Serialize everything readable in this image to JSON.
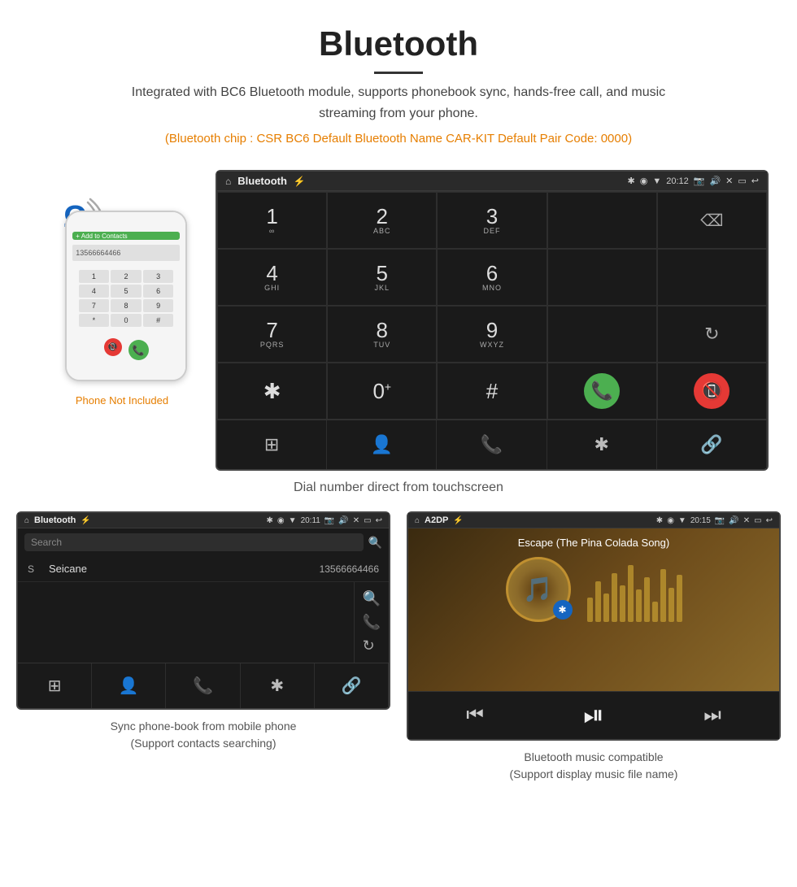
{
  "header": {
    "title": "Bluetooth",
    "subtitle": "Integrated with BC6 Bluetooth module, supports phonebook sync, hands-free call, and music streaming from your phone.",
    "orange_info": "(Bluetooth chip : CSR BC6    Default Bluetooth Name CAR-KIT    Default Pair Code: 0000)"
  },
  "dial_screen": {
    "statusbar": {
      "label": "Bluetooth",
      "time": "20:12",
      "icons": [
        "home",
        "bluetooth",
        "usb",
        "location",
        "signal"
      ]
    },
    "keypad": [
      {
        "num": "1",
        "sub": ""
      },
      {
        "num": "2",
        "sub": "ABC"
      },
      {
        "num": "3",
        "sub": "DEF"
      },
      {
        "empty": true
      },
      {
        "backspace": true
      },
      {
        "num": "4",
        "sub": "GHI"
      },
      {
        "num": "5",
        "sub": "JKL"
      },
      {
        "num": "6",
        "sub": "MNO"
      },
      {
        "empty": true
      },
      {
        "empty": true
      },
      {
        "num": "7",
        "sub": "PQRS"
      },
      {
        "num": "8",
        "sub": "TUV"
      },
      {
        "num": "9",
        "sub": "WXYZ"
      },
      {
        "empty": true
      },
      {
        "redial": true
      },
      {
        "num": "*",
        "sub": ""
      },
      {
        "num": "0",
        "sub": "+"
      },
      {
        "num": "#",
        "sub": ""
      },
      {
        "call_green": true
      },
      {
        "call_red": true
      }
    ],
    "bottom_icons": [
      "grid",
      "person",
      "phone",
      "bluetooth",
      "link"
    ],
    "caption": "Dial number direct from touchscreen"
  },
  "phonebook_screen": {
    "statusbar": {
      "label": "Bluetooth",
      "time": "20:11"
    },
    "search_placeholder": "Search",
    "contacts": [
      {
        "letter": "S",
        "name": "Seicane",
        "phone": "13566664466"
      }
    ],
    "bottom_icons": [
      "grid",
      "person",
      "phone",
      "bluetooth",
      "link"
    ],
    "caption_line1": "Sync phone-book from mobile phone",
    "caption_line2": "(Support contacts searching)"
  },
  "music_screen": {
    "statusbar": {
      "label": "A2DP",
      "time": "20:15"
    },
    "song_title": "Escape (The Pina Colada Song)",
    "caption_line1": "Bluetooth music compatible",
    "caption_line2": "(Support display music file name)"
  },
  "phone_side": {
    "not_included": "Phone Not Included"
  }
}
